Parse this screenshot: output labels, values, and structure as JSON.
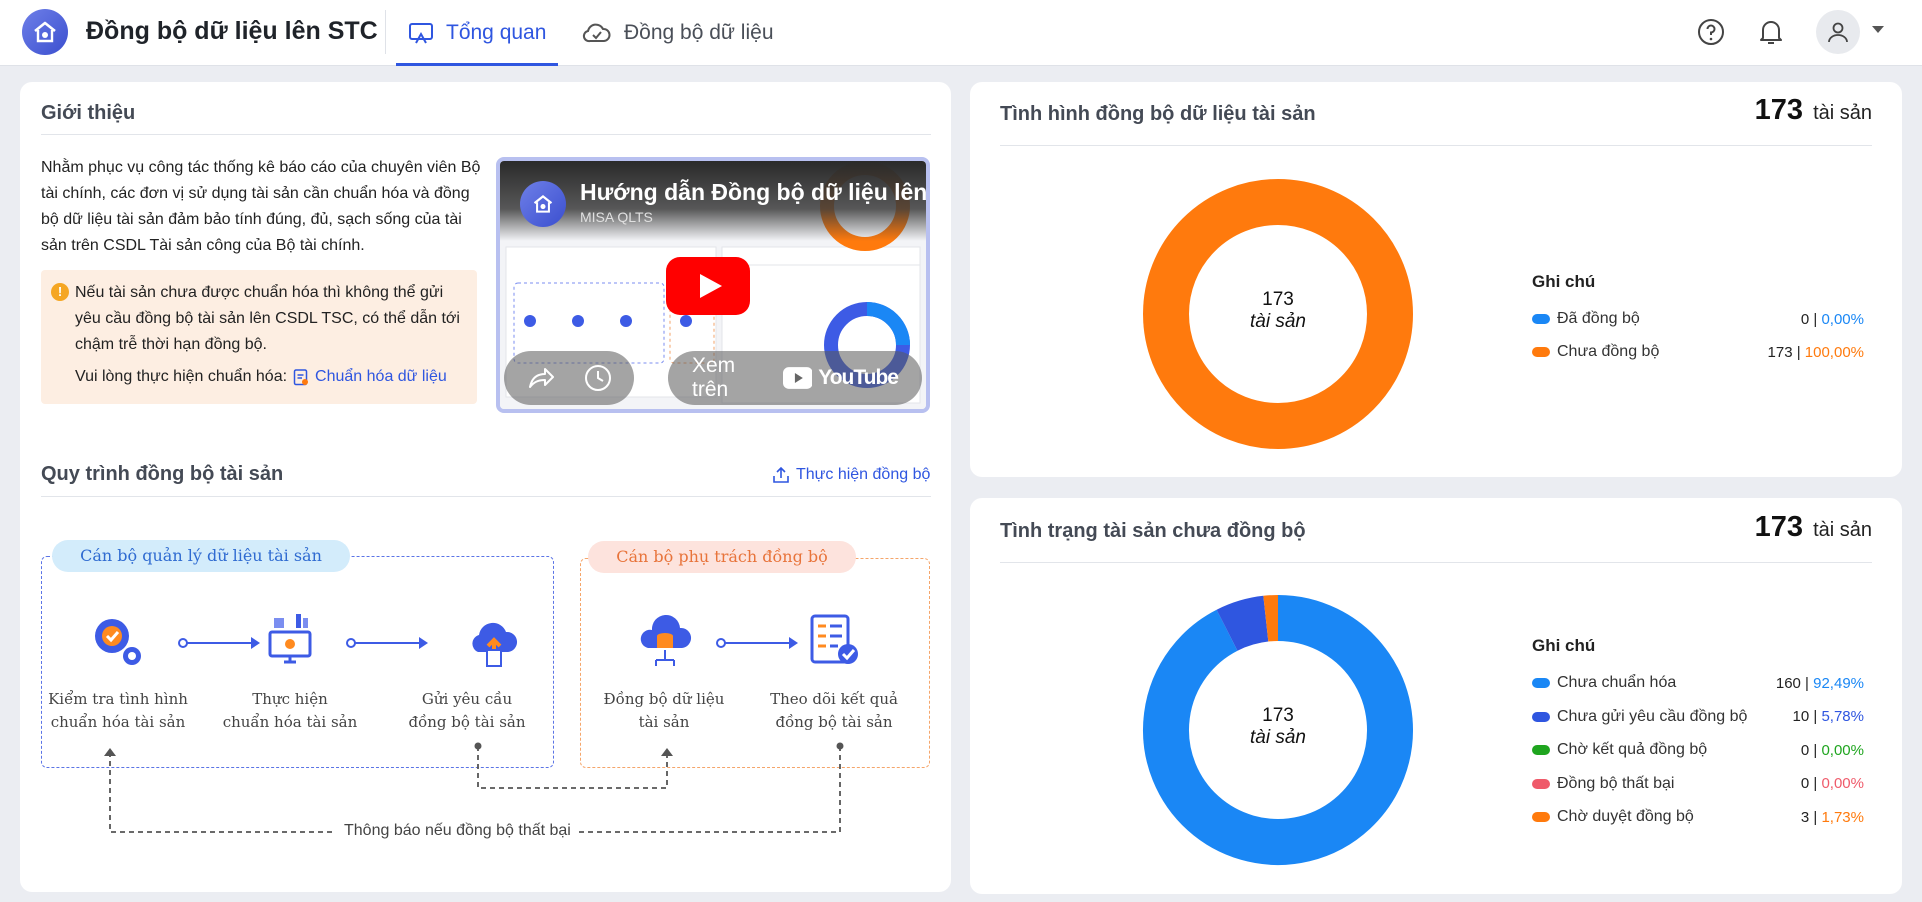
{
  "header": {
    "app_title": "Đồng bộ dữ liệu lên STC",
    "tabs": [
      {
        "label": "Tổng quan",
        "icon": "monitor-icon",
        "active": true
      },
      {
        "label": "Đồng bộ dữ liệu",
        "icon": "cloud-sync-icon",
        "active": false
      }
    ]
  },
  "intro": {
    "title": "Giới thiệu",
    "text": "Nhằm phục vụ công tác thống kê báo cáo của chuyên viên Bộ tài chính, các đơn vị sử dụng tài sản cần chuẩn hóa và đồng bộ dữ liệu tài sản đảm bảo tính đúng, đủ, sạch sống của tài sản trên CSDL Tài sản công của Bộ tài chính.",
    "warning": "Nếu tài sản chưa được chuẩn hóa thì không thể gửi yêu cầu đồng bộ tài sản lên CSDL TSC, có thể dẫn tới chậm trễ thời hạn đồng bộ.",
    "action_prompt": "Vui lòng thực hiện chuẩn hóa:",
    "action_link": "Chuẩn hóa dữ liệu",
    "video": {
      "title": "Hướng dẫn Đồng bộ dữ liệu lên C",
      "channel": "MISA QLTS",
      "watch_on": "Xem trên",
      "platform": "YouTube"
    }
  },
  "process": {
    "title": "Quy trình đồng bộ tài sản",
    "action": "Thực hiện đồng bộ",
    "group1_label": "Cán bộ quản lý dữ liệu tài sản",
    "group2_label": "Cán bộ phụ trách đồng bộ",
    "steps": [
      {
        "line1": "Kiểm tra tình hình",
        "line2": "chuẩn hóa tài sản"
      },
      {
        "line1": "Thực hiện",
        "line2": "chuẩn hóa tài sản"
      },
      {
        "line1": "Gửi yêu cầu",
        "line2": "đồng bộ tài sản"
      },
      {
        "line1": "Đồng bộ dữ liệu",
        "line2": "tài sản"
      },
      {
        "line1": "Theo dõi kết quả",
        "line2": "đồng bộ tài sản"
      }
    ],
    "notify": "Thông báo nếu đồng bộ thất bại"
  },
  "sync_status": {
    "title": "Tình hình đồng bộ dữ liệu tài sản",
    "total": "173",
    "unit": "tài sản",
    "legend_title": "Ghi chú",
    "items": [
      {
        "label": "Đã đồng bộ",
        "count": "0",
        "pct": "0,00%",
        "value": 0,
        "color": "#1a87f5"
      },
      {
        "label": "Chưa đồng bộ",
        "count": "173",
        "pct": "100,00%",
        "value": 173,
        "color": "#ff7a0d"
      }
    ]
  },
  "unsynced_status": {
    "title": "Tình trạng tài sản chưa đồng bộ",
    "total": "173",
    "unit": "tài sản",
    "legend_title": "Ghi chú",
    "items": [
      {
        "label": "Chưa chuẩn hóa",
        "count": "160",
        "pct": "92,49%",
        "value": 160,
        "color": "#1a87f5"
      },
      {
        "label": "Chưa gửi yêu cầu đồng bộ",
        "count": "10",
        "pct": "5,78%",
        "value": 10,
        "color": "#2f56e0"
      },
      {
        "label": "Chờ kết quả đồng bộ",
        "count": "0",
        "pct": "0,00%",
        "value": 0,
        "color": "#1fa51f"
      },
      {
        "label": "Đồng bộ thất bại",
        "count": "0",
        "pct": "0,00%",
        "value": 0,
        "color": "#ef5a6a"
      },
      {
        "label": "Chờ duyệt đồng bộ",
        "count": "3",
        "pct": "1,73%",
        "value": 3,
        "color": "#ff7a0d"
      }
    ]
  }
}
